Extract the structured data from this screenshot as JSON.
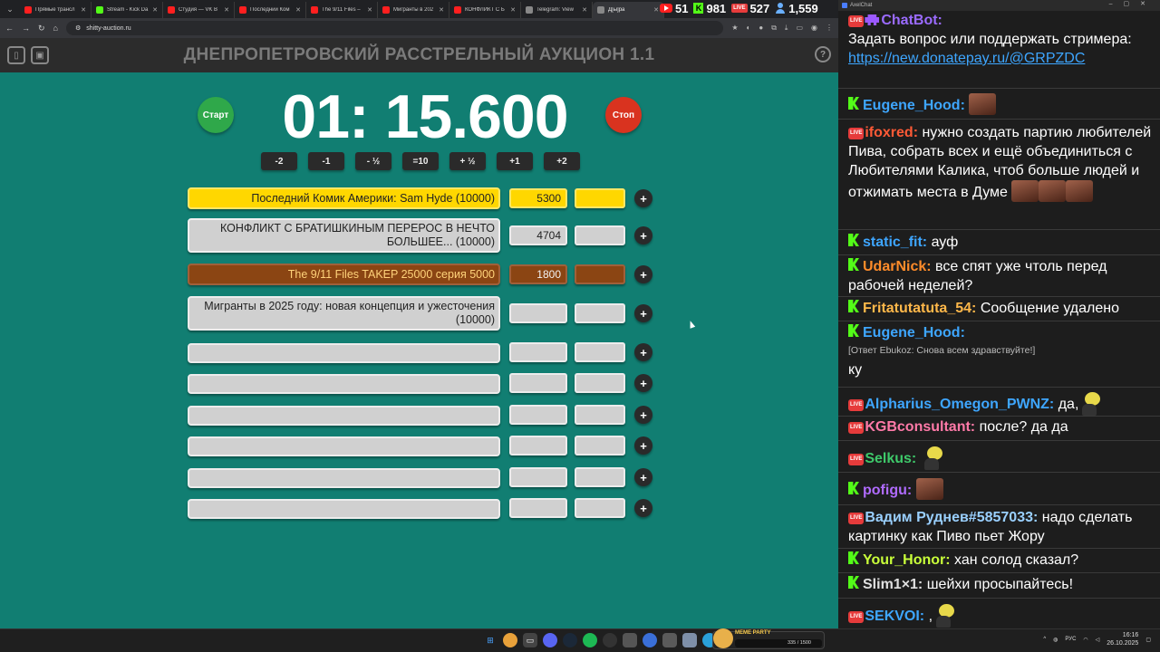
{
  "browser": {
    "tabs": [
      {
        "label": "Прямые трансл",
        "favicon_color": "#ff1f1f"
      },
      {
        "label": "Stream - Kick Da",
        "favicon_color": "#53fc18"
      },
      {
        "label": "Студия — VK В",
        "favicon_color": "#ff1f1f"
      },
      {
        "label": "Последний Ком",
        "favicon_color": "#ff1f1f"
      },
      {
        "label": "The 9/11 Files –",
        "favicon_color": "#ff1f1f"
      },
      {
        "label": "Мигранты в 202",
        "favicon_color": "#ff1f1f"
      },
      {
        "label": "КОНФЛИКТ С Б",
        "favicon_color": "#ff1f1f"
      },
      {
        "label": "Telegram: View",
        "favicon_color": "#888888"
      },
      {
        "label": "Д[ы]ра",
        "favicon_color": "#888888"
      }
    ],
    "url": "shitty-auction.ru"
  },
  "stream_stats": {
    "youtube": "51",
    "kick": "981",
    "vk_live": "527",
    "total": "1,559"
  },
  "auction": {
    "title": "ДНЕПРОПЕТРОВСКИЙ РАССТРЕЛЬНЫЙ АУКЦИОН 1.1",
    "start_label": "Старт",
    "stop_label": "Стоп",
    "timer": "01: 15.600",
    "adjust_buttons": [
      "-2",
      "-1",
      "- ½",
      "=10",
      "+ ½",
      "+1",
      "+2"
    ],
    "plus_label": "+",
    "lots": [
      {
        "name": "Последний Комик Америки: Sam Hyde (10000)",
        "amount": "5300",
        "style": "gold"
      },
      {
        "name": "КОНФЛИКТ С БРАТИШКИНЫМ ПЕРЕРОС В НЕЧТО БОЛЬШЕЕ... (10000)",
        "amount": "4704",
        "style": "gray"
      },
      {
        "name": "The 9/11 Files TAKEP 25000 серия 5000",
        "amount": "1800",
        "style": "brown"
      },
      {
        "name": "Мигранты в 2025 году: новая концепция и ужесточения (10000)",
        "amount": "",
        "style": "plain"
      },
      {
        "name": "",
        "amount": "",
        "style": "plain"
      },
      {
        "name": "",
        "amount": "",
        "style": "plain"
      },
      {
        "name": "",
        "amount": "",
        "style": "plain"
      },
      {
        "name": "",
        "amount": "",
        "style": "plain"
      },
      {
        "name": "",
        "amount": "",
        "style": "plain"
      },
      {
        "name": "",
        "amount": "",
        "style": "plain"
      }
    ]
  },
  "chat": {
    "window_title": "AxelChat",
    "messages": [
      {
        "platform": "vk",
        "user": "ChatBot:",
        "user_color": "#9b6bff",
        "text": "Задать вопрос или поддержать стримера:",
        "link": "https://new.donatepay.ru/@GRPZDC"
      },
      {
        "platform": "kick",
        "user": "Eugene_Hood:",
        "user_color": "#3ea6ff",
        "text": ""
      },
      {
        "platform": "vk",
        "user": "ifoxred:",
        "user_color": "#ff5a36",
        "text": "нужно создать партию любителей Пива, собрать всех и ещё объединиться с Любителями Калика, чтоб больше людей и отжимать места в Думе"
      },
      {
        "platform": "kick",
        "user": "static_fit:",
        "user_color": "#3ea6ff",
        "text": "ауф"
      },
      {
        "platform": "kick",
        "user": "UdarNick:",
        "user_color": "#ff8c2a",
        "text": "все спят уже чтоль перед рабочей неделей?"
      },
      {
        "platform": "kick",
        "user": "Fritatutatuta_54:",
        "user_color": "#ffb84a",
        "text": "Сообщение удалено"
      },
      {
        "platform": "kick",
        "user": "Eugene_Hood:",
        "user_color": "#3ea6ff",
        "reply": "[Ответ Ebukoz: Снова всем здравствуйте!]",
        "text": "ку"
      },
      {
        "platform": "vk",
        "user": "Alpharius_Omegon_PWNZ:",
        "user_color": "#3ea6ff",
        "text": "да,"
      },
      {
        "platform": "vk",
        "user": "KGBconsultant:",
        "user_color": "#ff7aa8",
        "text": "после? да да"
      },
      {
        "platform": "vk",
        "user": "Selkus:",
        "user_color": "#3ec96a",
        "text": ""
      },
      {
        "platform": "kick",
        "user": "pofigu:",
        "user_color": "#b06bff",
        "text": ""
      },
      {
        "platform": "vk",
        "user": "Вадим Руднев#5857033:",
        "user_color": "#9ad0ff",
        "text": "надо сделать картинку как Пиво пьет Жору"
      },
      {
        "platform": "kick",
        "user": "Your_Honor:",
        "user_color": "#c9ff3a",
        "text": "хан солод сказал?"
      },
      {
        "platform": "kick",
        "user": "Slim1×1:",
        "user_color": "#e0e0e0",
        "text": "шейхи просыпайтесь!"
      },
      {
        "platform": "vk",
        "user": "SEKVOI:",
        "user_color": "#3ea6ff",
        "text": ","
      }
    ]
  },
  "taskbar": {
    "meme_title": "MEME PARTY",
    "meme_progress": "335 / 1500",
    "lang": "РУС",
    "time": "16:16",
    "date": "26.10.2025"
  }
}
